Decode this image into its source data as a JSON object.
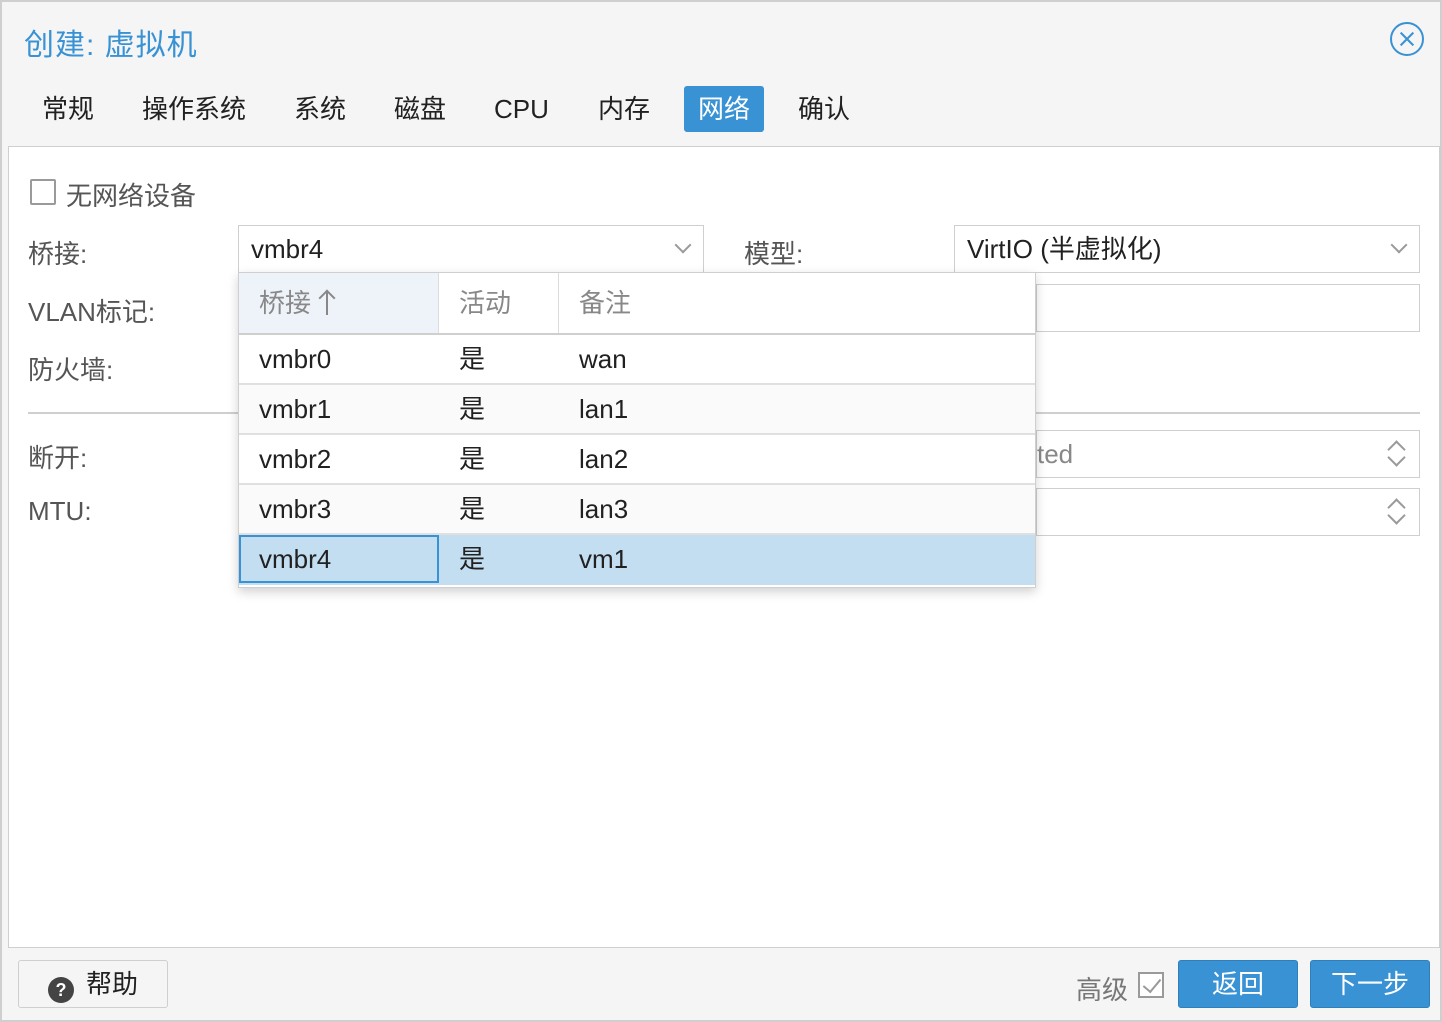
{
  "window": {
    "title": "创建: 虚拟机"
  },
  "tabs": [
    {
      "label": "常规"
    },
    {
      "label": "操作系统"
    },
    {
      "label": "系统"
    },
    {
      "label": "磁盘"
    },
    {
      "label": "CPU"
    },
    {
      "label": "内存"
    },
    {
      "label": "网络",
      "active": true
    },
    {
      "label": "确认"
    }
  ],
  "form": {
    "no_network_label": "无网络设备",
    "no_network_checked": false,
    "bridge_label": "桥接:",
    "bridge_value": "vmbr4",
    "model_label": "模型:",
    "model_value": "VirtIO (半虚拟化)",
    "vlan_label": "VLAN标记:",
    "firewall_label": "防火墙:",
    "disconnect_label": "断开:",
    "rate_partial": "ted",
    "mtu_label": "MTU:"
  },
  "bridge_dropdown": {
    "columns": [
      "桥接",
      "活动",
      "备注"
    ],
    "sorted_column": "桥接",
    "rows": [
      {
        "bridge": "vmbr0",
        "active": "是",
        "comment": "wan"
      },
      {
        "bridge": "vmbr1",
        "active": "是",
        "comment": "lan1"
      },
      {
        "bridge": "vmbr2",
        "active": "是",
        "comment": "lan2"
      },
      {
        "bridge": "vmbr3",
        "active": "是",
        "comment": "lan3"
      },
      {
        "bridge": "vmbr4",
        "active": "是",
        "comment": "vm1",
        "selected": true
      }
    ]
  },
  "footer": {
    "help_label": "帮助",
    "advanced_label": "高级",
    "advanced_checked": true,
    "back_label": "返回",
    "next_label": "下一步"
  },
  "colors": {
    "accent": "#3892d4",
    "selected_row": "#c3ddf1"
  }
}
